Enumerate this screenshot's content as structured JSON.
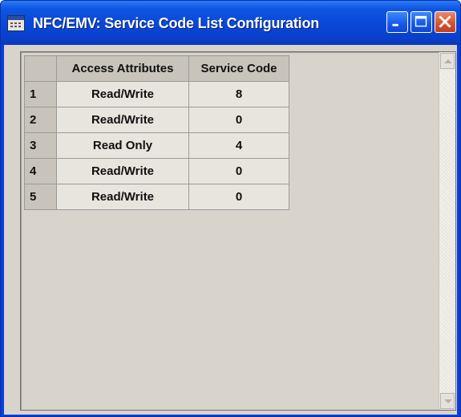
{
  "window": {
    "title": "NFC/EMV: Service Code List Configuration",
    "icon": "table-window-icon",
    "controls": [
      "minimize-icon",
      "maximize-icon",
      "close-icon"
    ]
  },
  "table": {
    "columns": [
      "Access Attributes",
      "Service Code"
    ],
    "rows": [
      {
        "index": "1",
        "access": "Read/Write",
        "service_code": "8"
      },
      {
        "index": "2",
        "access": "Read/Write",
        "service_code": "0"
      },
      {
        "index": "3",
        "access": "Read Only",
        "service_code": "4"
      },
      {
        "index": "4",
        "access": "Read/Write",
        "service_code": "0"
      },
      {
        "index": "5",
        "access": "Read/Write",
        "service_code": "0"
      }
    ]
  },
  "colors": {
    "titlebar": "#0a47d6",
    "client_background": "#d8d4cc",
    "close_button": "#d65532"
  }
}
